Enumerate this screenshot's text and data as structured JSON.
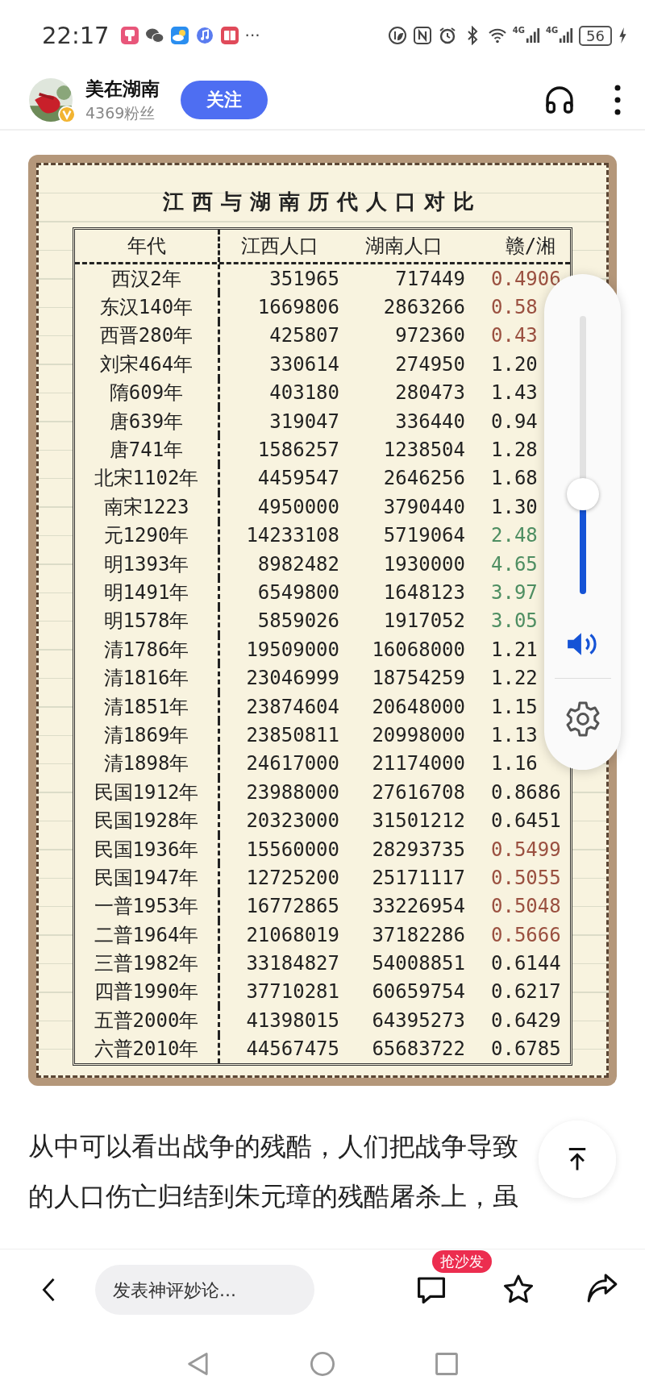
{
  "status_bar": {
    "time": "22:17",
    "more": "···",
    "network_1": "4G",
    "network_2": "4G",
    "battery": "56"
  },
  "author": {
    "name": "美在湖南",
    "followers": "4369粉丝",
    "follow_button": "关注",
    "verified": true
  },
  "table_image": {
    "title": "江西与湖南历代人口对比",
    "columns": [
      "年代",
      "江西人口",
      "湖南人口",
      "赣/湘"
    ],
    "rows": [
      {
        "era": "西汉2年",
        "jiangxi": "351965",
        "hunan": "717449",
        "ratio": "0.4906",
        "color": "#9a5040"
      },
      {
        "era": "东汉140年",
        "jiangxi": "1669806",
        "hunan": "2863266",
        "ratio": "0.58",
        "color": "#9a5040"
      },
      {
        "era": "西晋280年",
        "jiangxi": "425807",
        "hunan": "972360",
        "ratio": "0.43",
        "color": "#9a5040"
      },
      {
        "era": "刘宋464年",
        "jiangxi": "330614",
        "hunan": "274950",
        "ratio": "1.20",
        "color": "#222222"
      },
      {
        "era": "隋609年",
        "jiangxi": "403180",
        "hunan": "280473",
        "ratio": "1.43",
        "color": "#222222"
      },
      {
        "era": "唐639年",
        "jiangxi": "319047",
        "hunan": "336440",
        "ratio": "0.94",
        "color": "#222222"
      },
      {
        "era": "唐741年",
        "jiangxi": "1586257",
        "hunan": "1238504",
        "ratio": "1.28",
        "color": "#222222"
      },
      {
        "era": "北宋1102年",
        "jiangxi": "4459547",
        "hunan": "2646256",
        "ratio": "1.68",
        "color": "#222222"
      },
      {
        "era": "南宋1223",
        "jiangxi": "4950000",
        "hunan": "3790440",
        "ratio": "1.30",
        "color": "#222222"
      },
      {
        "era": "元1290年",
        "jiangxi": "14233108",
        "hunan": "5719064",
        "ratio": "2.48",
        "color": "#4e8e62"
      },
      {
        "era": "明1393年",
        "jiangxi": "8982482",
        "hunan": "1930000",
        "ratio": "4.65",
        "color": "#4e8e62"
      },
      {
        "era": "明1491年",
        "jiangxi": "6549800",
        "hunan": "1648123",
        "ratio": "3.97",
        "color": "#4e8e62"
      },
      {
        "era": "明1578年",
        "jiangxi": "5859026",
        "hunan": "1917052",
        "ratio": "3.05",
        "color": "#4e8e62"
      },
      {
        "era": "清1786年",
        "jiangxi": "19509000",
        "hunan": "16068000",
        "ratio": "1.21",
        "color": "#222222"
      },
      {
        "era": "清1816年",
        "jiangxi": "23046999",
        "hunan": "18754259",
        "ratio": "1.22",
        "color": "#222222"
      },
      {
        "era": "清1851年",
        "jiangxi": "23874604",
        "hunan": "20648000",
        "ratio": "1.15",
        "color": "#222222"
      },
      {
        "era": "清1869年",
        "jiangxi": "23850811",
        "hunan": "20998000",
        "ratio": "1.13",
        "color": "#222222"
      },
      {
        "era": "清1898年",
        "jiangxi": "24617000",
        "hunan": "21174000",
        "ratio": "1.16",
        "color": "#222222"
      },
      {
        "era": "民国1912年",
        "jiangxi": "23988000",
        "hunan": "27616708",
        "ratio": "0.8686",
        "color": "#222222"
      },
      {
        "era": "民国1928年",
        "jiangxi": "20323000",
        "hunan": "31501212",
        "ratio": "0.6451",
        "color": "#222222"
      },
      {
        "era": "民国1936年",
        "jiangxi": "15560000",
        "hunan": "28293735",
        "ratio": "0.5499",
        "color": "#9a5040"
      },
      {
        "era": "民国1947年",
        "jiangxi": "12725200",
        "hunan": "25171117",
        "ratio": "0.5055",
        "color": "#9a5040"
      },
      {
        "era": "一普1953年",
        "jiangxi": "16772865",
        "hunan": "33226954",
        "ratio": "0.5048",
        "color": "#9a5040"
      },
      {
        "era": "二普1964年",
        "jiangxi": "21068019",
        "hunan": "37182286",
        "ratio": "0.5666",
        "color": "#9a5040"
      },
      {
        "era": "三普1982年",
        "jiangxi": "33184827",
        "hunan": "54008851",
        "ratio": "0.6144",
        "color": "#222222"
      },
      {
        "era": "四普1990年",
        "jiangxi": "37710281",
        "hunan": "60659754",
        "ratio": "0.6217",
        "color": "#222222"
      },
      {
        "era": "五普2000年",
        "jiangxi": "41398015",
        "hunan": "64395273",
        "ratio": "0.6429",
        "color": "#222222"
      },
      {
        "era": "六普2010年",
        "jiangxi": "44567475",
        "hunan": "65683722",
        "ratio": "0.6785",
        "color": "#222222"
      }
    ]
  },
  "volume_panel": {
    "level": 0.36
  },
  "article": {
    "paragraph": "从中可以看出战争的残酷，人们把战争导致的人口伤亡归结到朱元璋的残酷屠杀上，虽"
  },
  "comment_bar": {
    "placeholder": "发表神评妙论...",
    "badge": "抢沙发"
  }
}
